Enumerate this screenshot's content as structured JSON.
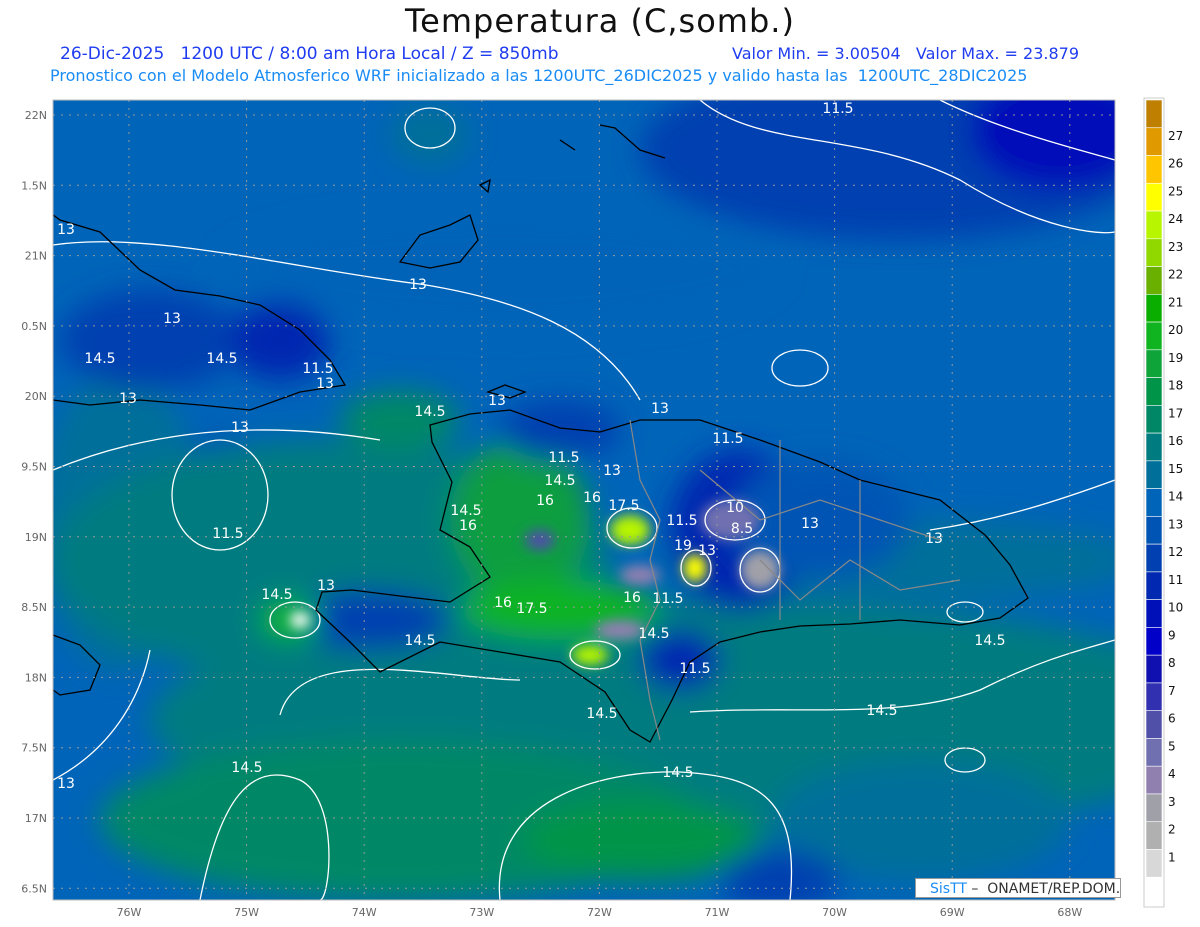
{
  "header": {
    "title": "Temperatura (C,somb.)",
    "line1": "26-Dic-2025   1200 UTC / 8:00 am Hora Local / Z = 850mb",
    "line1_right": "Valor Min. = 3.00504   Valor Max. = 23.879",
    "line2": "Pronostico con el Modelo Atmosferico WRF inicializado a las 1200UTC_26DIC2025 y valido hasta las  1200UTC_28DIC2025"
  },
  "map": {
    "lat_labels": [
      "22N",
      "1.5N",
      "21N",
      "0.5N",
      "20N",
      "9.5N",
      "19N",
      "8.5N",
      "18N",
      "7.5N",
      "17N",
      "6.5N"
    ],
    "lon_labels": [
      "76W",
      "75W",
      "74W",
      "73W",
      "72W",
      "71W",
      "70W",
      "69W",
      "68W"
    ],
    "contour_labels": [
      "11.5",
      "13",
      "13",
      "13",
      "14.5",
      "14.5",
      "11.5",
      "13",
      "13",
      "13",
      "14.5",
      "13",
      "13",
      "11.5",
      "11.5",
      "13",
      "14.5",
      "14.5",
      "16",
      "16",
      "16",
      "17.5",
      "11.5",
      "10",
      "8.5",
      "13",
      "13",
      "11.5",
      "19",
      "13",
      "14.5",
      "13",
      "16",
      "17.5",
      "16",
      "11.5",
      "14.5",
      "14.5",
      "11.5",
      "14.5",
      "14.5",
      "14.5",
      "14.5",
      "14.5",
      "13"
    ]
  },
  "colorbar": {
    "labels": [
      "27",
      "26",
      "25",
      "24",
      "23",
      "22",
      "21",
      "20",
      "19",
      "18",
      "17",
      "16",
      "15",
      "14",
      "13",
      "12",
      "11",
      "10",
      "9",
      "8",
      "7",
      "6",
      "5",
      "4",
      "3",
      "2",
      "1"
    ],
    "colors": [
      "#bf7f00",
      "#e09a00",
      "#ffc600",
      "#ffff00",
      "#b8f500",
      "#90d800",
      "#6ab000",
      "#0aae00",
      "#10b420",
      "#0ea43a",
      "#009448",
      "#008866",
      "#007c80",
      "#006f9a",
      "#0064b8",
      "#0054b4",
      "#0040b0",
      "#0028b0",
      "#0010b8",
      "#0000c8",
      "#1010b0",
      "#3030b0",
      "#5050a8",
      "#7070b0",
      "#9080b0",
      "#a0a0a8",
      "#b0b0b0",
      "#d8d8d8",
      "#ffffff"
    ]
  },
  "watermark": {
    "brand": "SisTT",
    "text": " –  ONAMET/REP.DOM."
  }
}
